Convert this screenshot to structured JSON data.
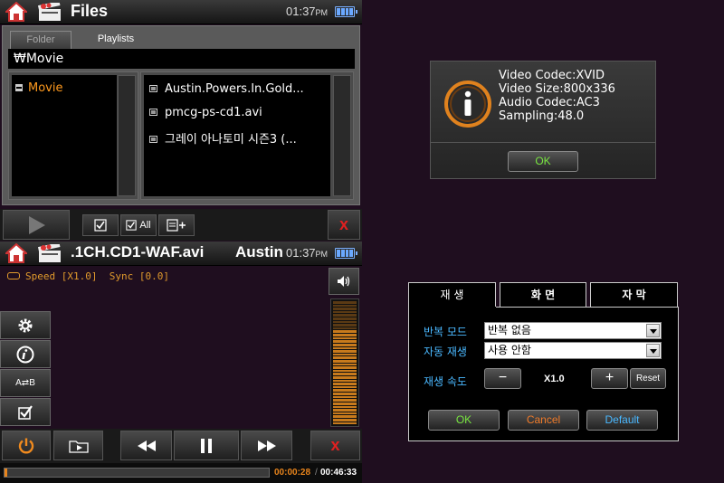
{
  "files_screen": {
    "title": "Files",
    "clock": {
      "time": "01:37",
      "ampm": "PM"
    },
    "tabs": [
      {
        "label": "Folder",
        "active": true
      },
      {
        "label": "Playlists",
        "active": false
      }
    ],
    "path": "₩Movie",
    "tree": [
      {
        "label": "Movie",
        "expanded": true
      }
    ],
    "files": [
      {
        "name": "Austin.Powers.In.Gold..."
      },
      {
        "name": "pmcg-ps-cd1.avi"
      },
      {
        "name": "그레이 아나토미 시즌3 (..."
      }
    ],
    "toolbar": {
      "check_all_label": "All"
    }
  },
  "player_screen": {
    "title_left": ".1CH.CD1-WAF.avi",
    "title_right": "Austin.I",
    "clock": {
      "time": "01:37",
      "ampm": "PM"
    },
    "speed_text": "Speed [X1.0]",
    "sync_text": "Sync [0.0]",
    "ab_label": "A⇄B",
    "volume_level": 0.75,
    "progress_fraction": 0.01,
    "current_time": "00:00:28",
    "separator": "/",
    "total_time": "00:46:33"
  },
  "info_dialog": {
    "lines": [
      "Video Codec:XVID",
      "Video Size:800x336",
      "Audio Codec:AC3",
      "Sampling:48.0"
    ],
    "ok_label": "OK"
  },
  "settings_dialog": {
    "tabs": [
      {
        "label": "재 생",
        "active": true
      },
      {
        "label": "화 면",
        "active": false
      },
      {
        "label": "자 막",
        "active": false
      }
    ],
    "repeat_label": "반복 모드",
    "repeat_value": "반복 없음",
    "autoplay_label": "자동 재생",
    "autoplay_value": "사용 안함",
    "speed_label": "재생 속도",
    "speed_minus": "−",
    "speed_value": "X1.0",
    "speed_plus": "+",
    "reset_label": "Reset",
    "ok_label": "OK",
    "cancel_label": "Cancel",
    "default_label": "Default"
  },
  "colors": {
    "accent_orange": "#ff9a1e",
    "ok_green": "#79e641",
    "cancel_orange": "#f07b2a",
    "default_blue": "#4ab8ff",
    "close_red": "#e02020"
  }
}
